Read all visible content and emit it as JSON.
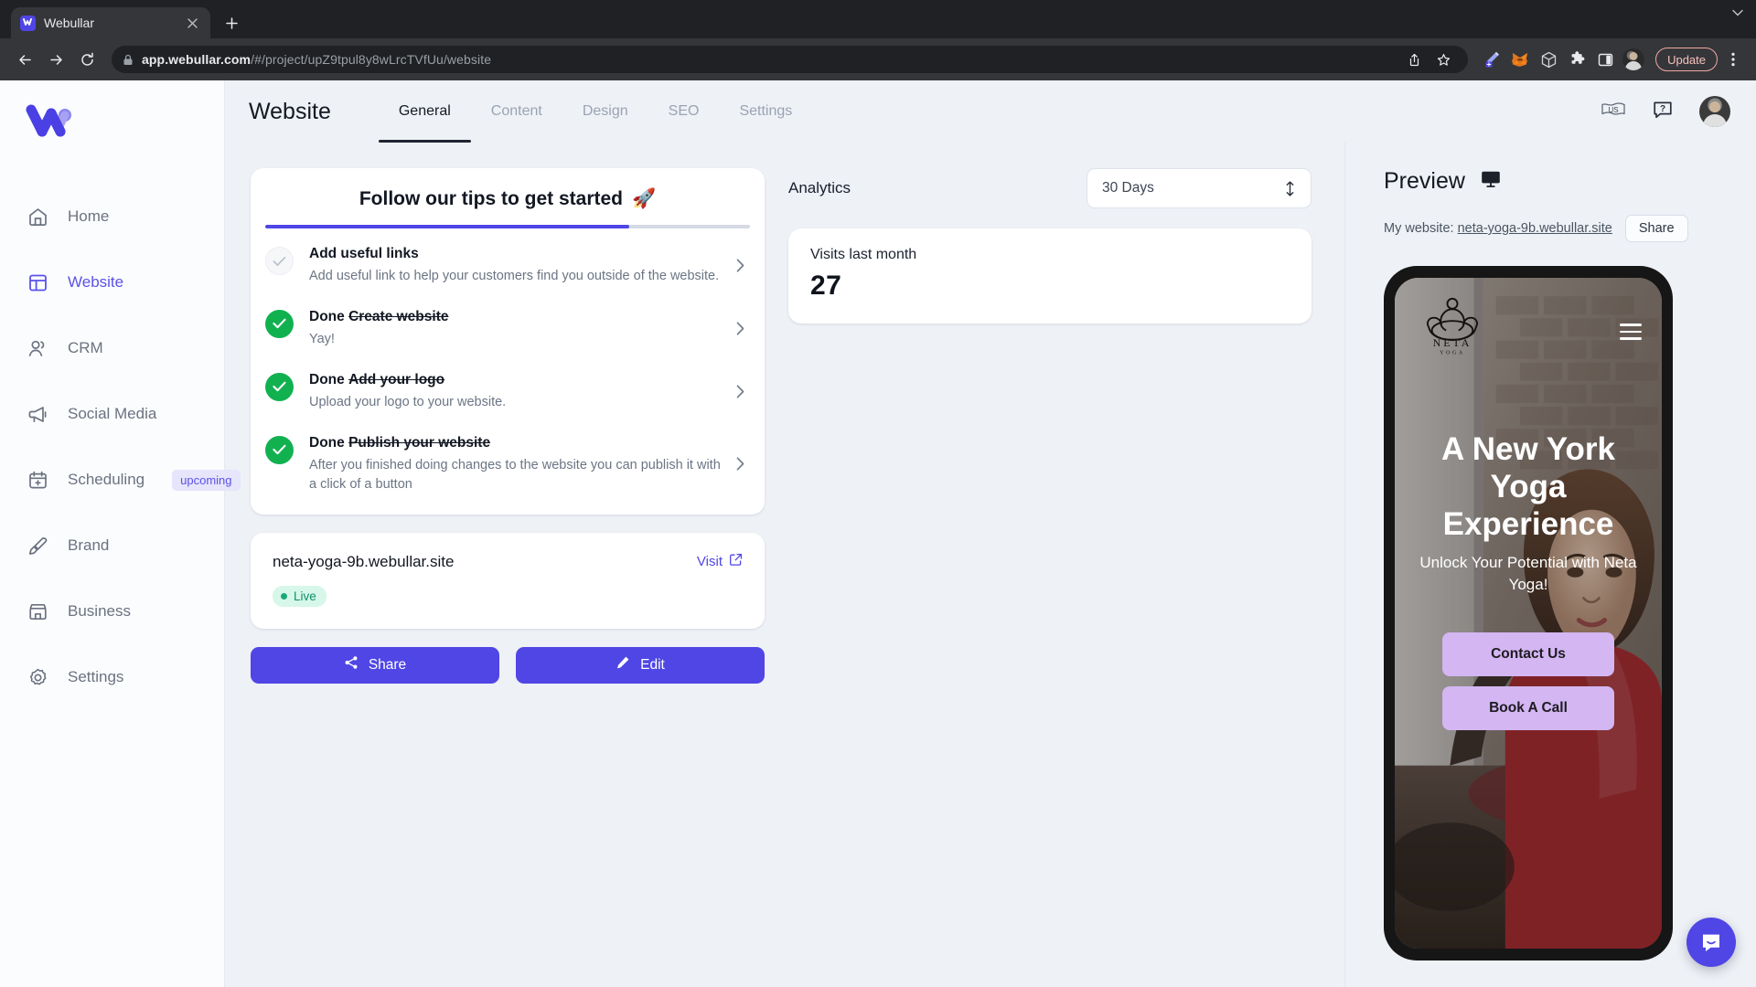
{
  "browser": {
    "tab": {
      "title": "Webullar",
      "favicon": "webullar-logo-icon",
      "close": "close-icon"
    },
    "new_tab": "+",
    "nav": {
      "back": "back-arrow-icon",
      "forward": "forward-arrow-icon",
      "reload": "reload-icon"
    },
    "omnibox": {
      "lock": "lock-icon",
      "url_host": "app.webullar.com",
      "url_path": "/#/project/upZ9tpul8y8wLrcTVfUu/website",
      "share": "share-icon",
      "bookmark": "star-icon"
    },
    "extensions": [
      "wand-extension-icon",
      "metamask-fox-icon",
      "box-extension-icon",
      "puzzle-extensions-icon",
      "side-panel-icon",
      "browser-profile-avatar"
    ],
    "update_label": "Update",
    "menu": "kebab-menu-icon"
  },
  "sidebar": {
    "logo": "webullar-w-logo",
    "items": [
      {
        "label": "Home",
        "icon": "home-icon",
        "active": false
      },
      {
        "label": "Website",
        "icon": "layout-icon",
        "active": true
      },
      {
        "label": "CRM",
        "icon": "people-icon",
        "active": false
      },
      {
        "label": "Social Media",
        "icon": "megaphone-icon",
        "active": false
      },
      {
        "label": "Scheduling",
        "icon": "calendar-plus-icon",
        "active": false,
        "badge": "upcoming"
      },
      {
        "label": "Brand",
        "icon": "paintbrush-icon",
        "active": false
      },
      {
        "label": "Business",
        "icon": "storefront-icon",
        "active": false
      },
      {
        "label": "Settings",
        "icon": "gear-icon",
        "active": false
      }
    ]
  },
  "header": {
    "title": "Website",
    "tabs": [
      {
        "label": "General",
        "active": true
      },
      {
        "label": "Content",
        "active": false
      },
      {
        "label": "Design",
        "active": false
      },
      {
        "label": "SEO",
        "active": false
      },
      {
        "label": "Settings",
        "active": false
      }
    ],
    "language": "US",
    "help": "help-icon",
    "avatar": "user-avatar"
  },
  "tips": {
    "title": "Follow our tips to get started",
    "title_emoji": "🚀",
    "progress_percent": 75,
    "tasks": [
      {
        "state": "open",
        "prefix": "",
        "name": "Add useful links",
        "desc": "Add useful link to help your customers find you outside of the website."
      },
      {
        "state": "done",
        "prefix": "Done",
        "name": "Create website",
        "desc": "Yay!"
      },
      {
        "state": "done",
        "prefix": "Done",
        "name": "Add your logo",
        "desc": "Upload your logo to your website."
      },
      {
        "state": "done",
        "prefix": "Done",
        "name": "Publish your website",
        "desc": "After you finished doing changes to the website you can publish it with a click of a button"
      }
    ]
  },
  "domain_card": {
    "domain": "neta-yoga-9b.webullar.site",
    "visit_label": "Visit",
    "visit_icon": "external-link-icon",
    "status": "Live"
  },
  "actions": {
    "share_label": "Share",
    "share_icon": "share-nodes-icon",
    "edit_label": "Edit",
    "edit_icon": "pencil-icon"
  },
  "analytics": {
    "title": "Analytics",
    "range_selected": "30 Days",
    "range_icon": "updown-arrows-icon",
    "stat_label": "Visits last month",
    "stat_value": "27"
  },
  "preview": {
    "title": "Preview",
    "device_icon": "monitor-icon",
    "my_website_prefix": "My website:",
    "my_website_url": "neta-yoga-9b.webullar.site",
    "share_label": "Share",
    "site": {
      "logo_name": "NETA",
      "logo_sub": "YOGA",
      "menu_icon": "hamburger-menu-icon",
      "headline": "A New York Yoga Experience",
      "subheadline": "Unlock Your Potential with Neta Yoga!",
      "cta_primary": "Contact Us",
      "cta_secondary": "Book A Call"
    }
  },
  "chat_launcher": {
    "icon": "intercom-chat-icon"
  },
  "colors": {
    "accent": "#4f46e5",
    "success": "#12b150",
    "live_badge_bg": "#d6f7e9",
    "live_badge_text": "#0f8f6a",
    "cta_button": "#d3b6f2",
    "app_bg": "#eef1f6"
  }
}
